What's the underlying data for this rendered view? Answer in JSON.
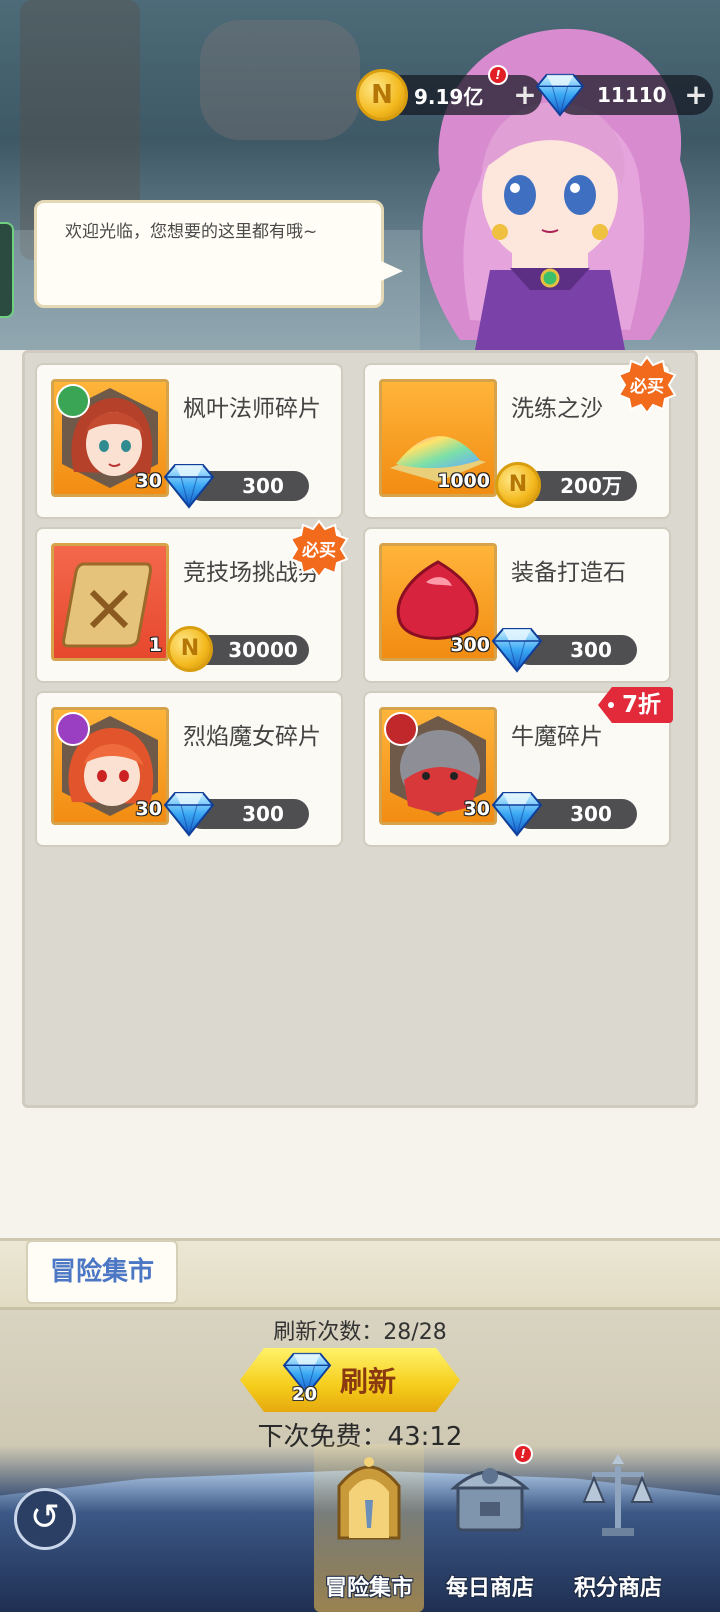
{
  "resources": {
    "gold": {
      "value": "9.19亿",
      "plus": "+",
      "coin_letter": "N"
    },
    "gems": {
      "value": "11110",
      "plus": "+"
    }
  },
  "dialog": {
    "text": "欢迎光临，您想要的这里都有哦~"
  },
  "shop_items": [
    {
      "name": "枫叶法师碎片",
      "qty": "30",
      "price": "300",
      "currency": "gem",
      "tag": ""
    },
    {
      "name": "洗练之沙",
      "qty": "1000",
      "price": "200万",
      "currency": "gold",
      "tag": "必买"
    },
    {
      "name": "竞技场挑战券",
      "qty": "1",
      "price": "30000",
      "currency": "gold",
      "tag": "必买"
    },
    {
      "name": "装备打造石",
      "qty": "300",
      "price": "300",
      "currency": "gem",
      "tag": ""
    },
    {
      "name": "烈焰魔女碎片",
      "qty": "30",
      "price": "300",
      "currency": "gem",
      "tag": ""
    },
    {
      "name": "牛魔碎片",
      "qty": "30",
      "price": "300",
      "currency": "gem",
      "tag": "7折"
    }
  ],
  "market_tab": {
    "label": "冒险集市"
  },
  "refresh": {
    "count_text": "刷新次数：28/28",
    "button_label": "刷新",
    "cost": "20",
    "next_free": "下次免费：43:12"
  },
  "bottom_nav": {
    "items": [
      {
        "label": "冒险集市",
        "icon": "adventure-market-icon",
        "active": true
      },
      {
        "label": "每日商店",
        "icon": "daily-shop-icon",
        "active": false
      },
      {
        "label": "积分商店",
        "icon": "points-shop-icon",
        "active": false
      }
    ],
    "notification": "!"
  },
  "colors": {
    "accent_gold": "#f5cc1a",
    "price_pill": "#4f4f51",
    "discount_red": "#e22a3a",
    "market_blue": "#4b77c4"
  }
}
